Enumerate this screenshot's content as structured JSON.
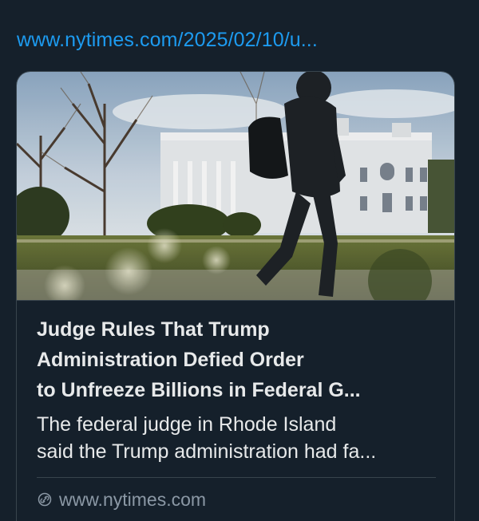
{
  "post": {
    "url_text": "www.nytimes.com/2025/02/10/u..."
  },
  "card": {
    "image": {
      "icon": "photo",
      "alt_subject": "person walking in front of the White House"
    },
    "title_lines": [
      "Judge Rules That Trump",
      "Administration Defied Order",
      "to Unfreeze Billions in Federal G..."
    ],
    "description_lines": [
      "The federal judge in Rhode Island",
      "said the Trump administration had fa..."
    ],
    "source": {
      "icon": "link-icon",
      "domain": "www.nytimes.com"
    }
  },
  "colors": {
    "background": "#15202b",
    "link": "#1d9bf0",
    "text_primary": "#e7e9ea",
    "text_secondary": "#8b98a5",
    "border": "#38444d"
  }
}
